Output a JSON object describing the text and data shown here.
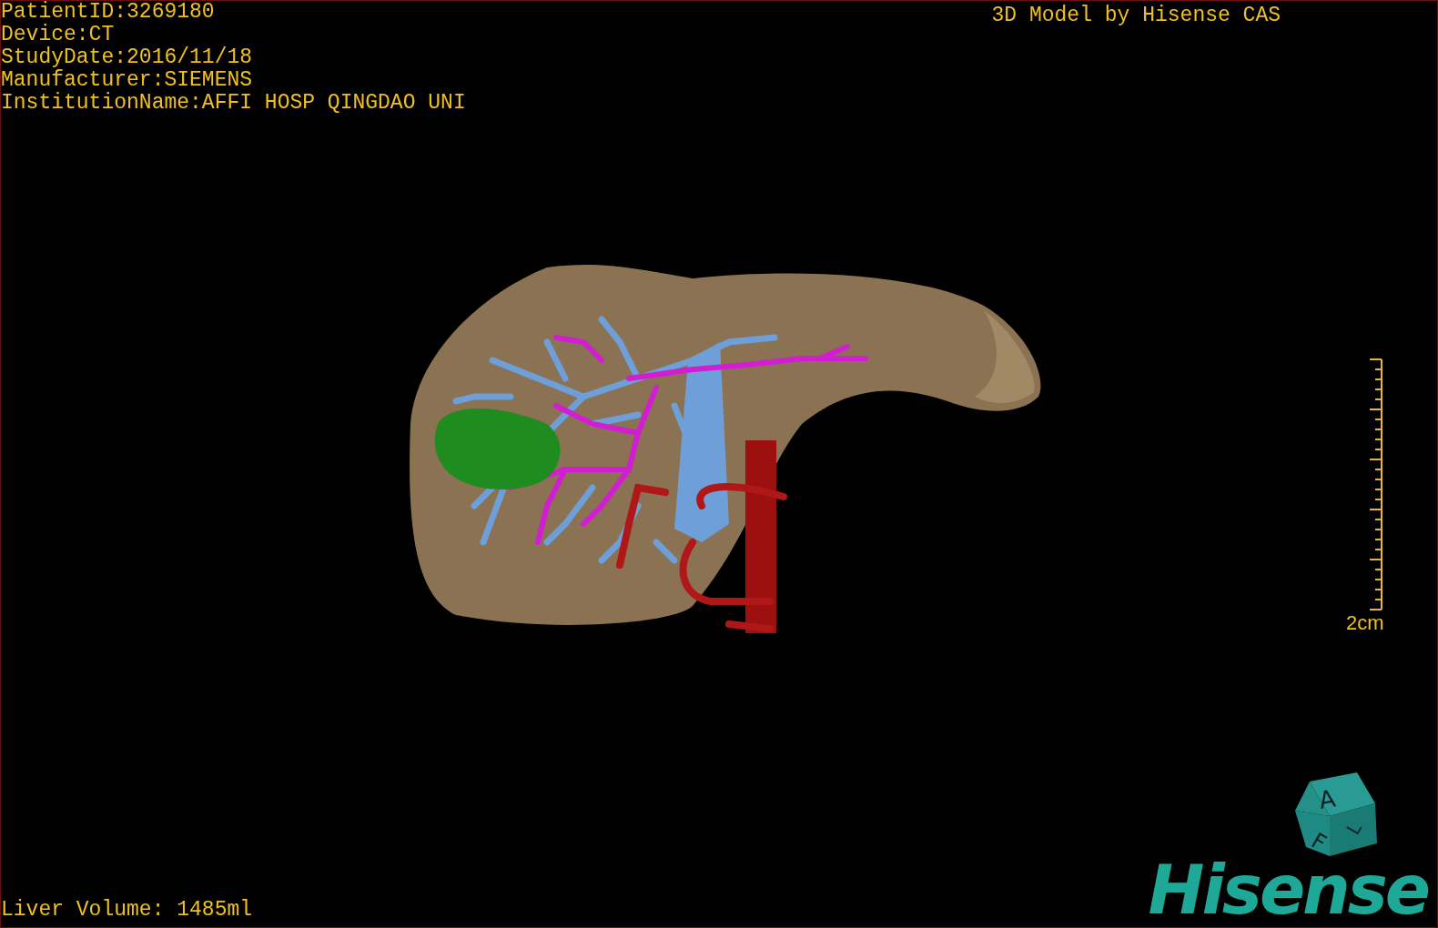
{
  "patient_info": [
    "PatientID:3269180",
    "Device:CT",
    "StudyDate:2016/11/18",
    "Manufacturer:SIEMENS",
    "InstitutionName:AFFI HOSP QINGDAO UNI"
  ],
  "title": "3D Model by Hisense CAS",
  "scale_bar": {
    "label": "2cm"
  },
  "orientation_cube": {
    "faces": [
      "A",
      "F",
      "L"
    ]
  },
  "logo": "Hisense",
  "liver_volume": "Liver Volume: 1485ml"
}
